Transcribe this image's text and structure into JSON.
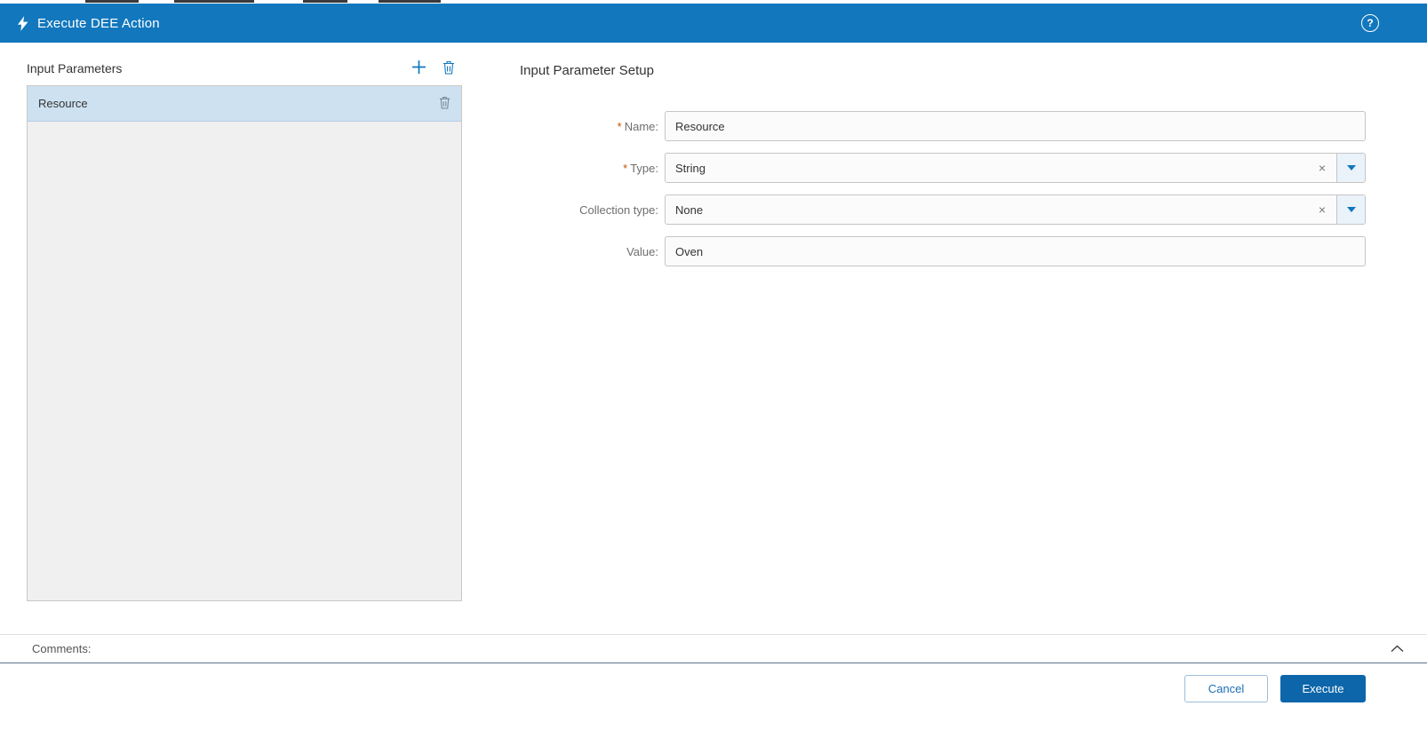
{
  "header": {
    "title": "Execute DEE Action",
    "help_glyph": "?"
  },
  "left_panel": {
    "title": "Input Parameters",
    "items": [
      {
        "name": "Resource",
        "selected": true
      }
    ]
  },
  "right_panel": {
    "title": "Input Parameter Setup",
    "required_marker": "*",
    "fields": {
      "name": {
        "label": "Name:",
        "value": "Resource",
        "required": true,
        "control": "text"
      },
      "type": {
        "label": "Type:",
        "value": "String",
        "required": true,
        "control": "combo"
      },
      "collection_type": {
        "label": "Collection type:",
        "value": "None",
        "required": false,
        "control": "combo"
      },
      "value": {
        "label": "Value:",
        "value": "Oven",
        "required": false,
        "control": "text"
      }
    }
  },
  "icons": {
    "clear_glyph": "×"
  },
  "comments": {
    "label": "Comments:"
  },
  "footer": {
    "cancel_label": "Cancel",
    "execute_label": "Execute"
  },
  "colors": {
    "header_blue": "#1277bd",
    "accent_blue": "#1277bd",
    "primary_button_blue": "#0d66aa",
    "required_marker_orange": "#c25400",
    "selected_row_blue": "#cde1f1",
    "list_background_gray": "#f0f0f0"
  }
}
